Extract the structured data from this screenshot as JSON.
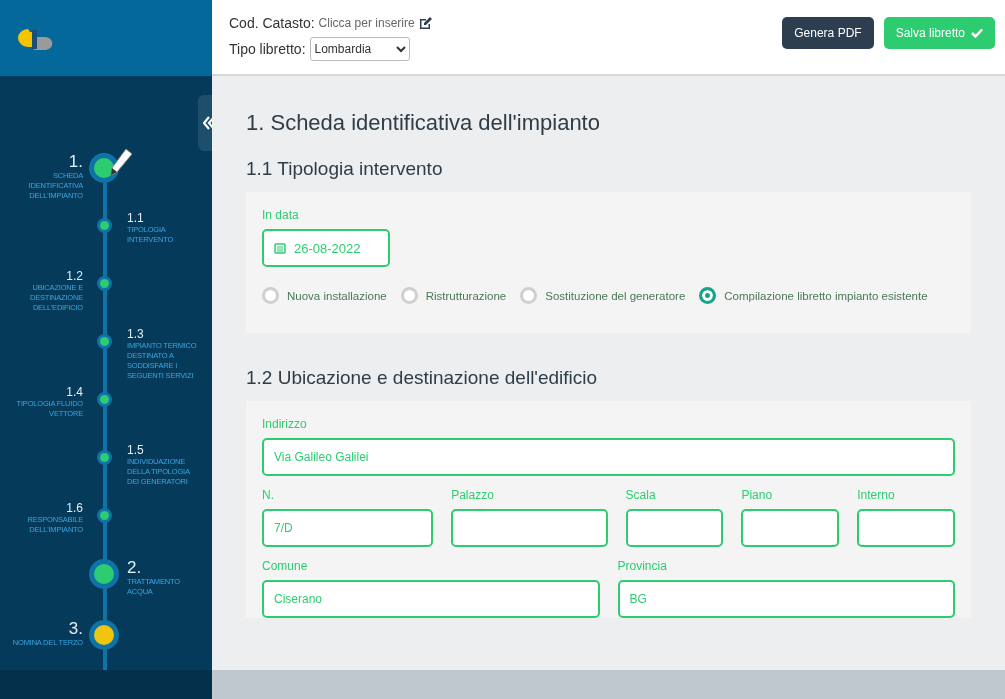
{
  "header": {
    "cadastral_code": {
      "label": "Cod. Catasto:",
      "placeholder": "Clicca per inserire"
    },
    "booklet_type": {
      "label": "Tipo libretto:",
      "value": "Lombardia"
    },
    "buttons": [
      {
        "kind": "secondary",
        "label": "Genera PDF"
      },
      {
        "kind": "primary",
        "label": "Salva libretto"
      }
    ]
  },
  "timeline": [
    {
      "number": "1.",
      "label": "SCHEDA IDENTIFICATIVA DELL'IMPIANTO",
      "kind": "step",
      "color": "#2ecc71",
      "current": true
    },
    {
      "number": "1.1",
      "label": "TIPOLOGIA INTERVENTO",
      "kind": "sub",
      "color": "#2ecc71",
      "current": false
    },
    {
      "number": "1.2",
      "label": "UBICAZIONE E DESTINAZIONE DELL'EDIFICIO",
      "kind": "sub",
      "color": "#2ecc71",
      "current": false
    },
    {
      "number": "1.3",
      "label": "IMPIANTO TERMICO DESTINATO A SODDISFARE I SEGUENTI SERVIZI",
      "kind": "sub",
      "color": "#2ecc71",
      "current": false
    },
    {
      "number": "1.4",
      "label": "TIPOLOGIA FLUIDO VETTORE",
      "kind": "sub",
      "color": "#2ecc71",
      "current": false
    },
    {
      "number": "1.5",
      "label": "INDIVIDUAZIONE DELLA TIPOLOGIA DEI GENERATORI",
      "kind": "sub",
      "color": "#2ecc71",
      "current": false
    },
    {
      "number": "1.6",
      "label": "RESPONSABILE DELL'IMPIANTO",
      "kind": "sub",
      "color": "#2ecc71",
      "current": false
    },
    {
      "number": "2.",
      "label": "TRATTAMENTO ACQUA",
      "kind": "step",
      "color": "#2ecc71",
      "current": false
    },
    {
      "number": "3.",
      "label": "NOMINA DEL TERZO",
      "kind": "step",
      "color": "#f1c40f",
      "current": false
    }
  ],
  "page_title": "1. Scheda identificativa dell'impianto",
  "sections": [
    {
      "title": "1.1 Tipologia intervento",
      "date_field": {
        "label": "In data",
        "value": "26-08-2022"
      },
      "radios": [
        {
          "label": "Nuova installazione",
          "selected": false
        },
        {
          "label": "Ristrutturazione",
          "selected": false
        },
        {
          "label": "Sostituzione del generatore",
          "selected": false
        },
        {
          "label": "Compilazione libretto impianto esistente",
          "selected": true
        }
      ]
    },
    {
      "title": "1.2 Ubicazione e destinazione dell'edificio",
      "field_rows": [
        [
          {
            "label": "Indirizzo",
            "value": "Via Galileo Galilei"
          }
        ],
        [
          {
            "label": "N.",
            "value": "7/D"
          },
          {
            "label": "Palazzo"
          },
          {
            "label": "Scala"
          },
          {
            "label": "Piano"
          },
          {
            "label": "Interno"
          }
        ],
        [
          {
            "label": "Comune",
            "value": "Ciserano"
          },
          {
            "label": "Provincia",
            "value": "BG"
          }
        ]
      ]
    }
  ]
}
